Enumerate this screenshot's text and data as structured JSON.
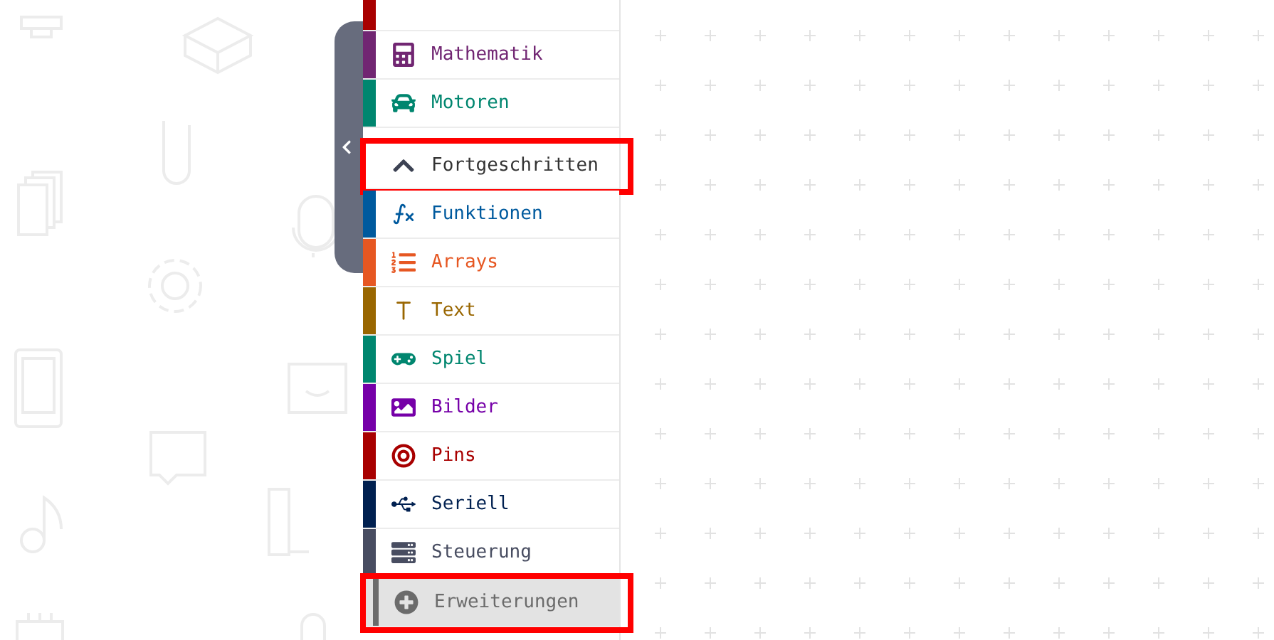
{
  "toolbox": {
    "collapse_tab": {
      "kind": "collapse"
    },
    "items": [
      {
        "kind": "category",
        "color": "#a80000"
      },
      {
        "kind": "category",
        "label": "Mathematik",
        "color": "#712672",
        "highlighted": false
      },
      {
        "kind": "category",
        "label": "Motoren",
        "color": "#00866f",
        "highlighted": false
      },
      {
        "kind": "gap"
      },
      {
        "kind": "toggle",
        "label": "Fortgeschritten",
        "color": "#3c4253",
        "highlighted": true
      },
      {
        "kind": "category",
        "label": "Funktionen",
        "color": "#005a9e",
        "highlighted": false
      },
      {
        "kind": "category",
        "label": "Arrays",
        "color": "#e65722",
        "highlighted": false
      },
      {
        "kind": "category",
        "label": "Text",
        "color": "#996600",
        "highlighted": false
      },
      {
        "kind": "category",
        "label": "Spiel",
        "color": "#00866f",
        "highlighted": false
      },
      {
        "kind": "category",
        "label": "Bilder",
        "color": "#7600a8",
        "highlighted": false
      },
      {
        "kind": "category",
        "label": "Pins",
        "color": "#a80000",
        "highlighted": false
      },
      {
        "kind": "category",
        "label": "Seriell",
        "color": "#002050",
        "highlighted": false
      },
      {
        "kind": "category",
        "label": "Steuerung",
        "color": "#484d61",
        "highlighted": false
      },
      {
        "kind": "extension",
        "label": "Erweiterungen",
        "color": "#6b6b6b",
        "highlighted": true
      }
    ]
  }
}
